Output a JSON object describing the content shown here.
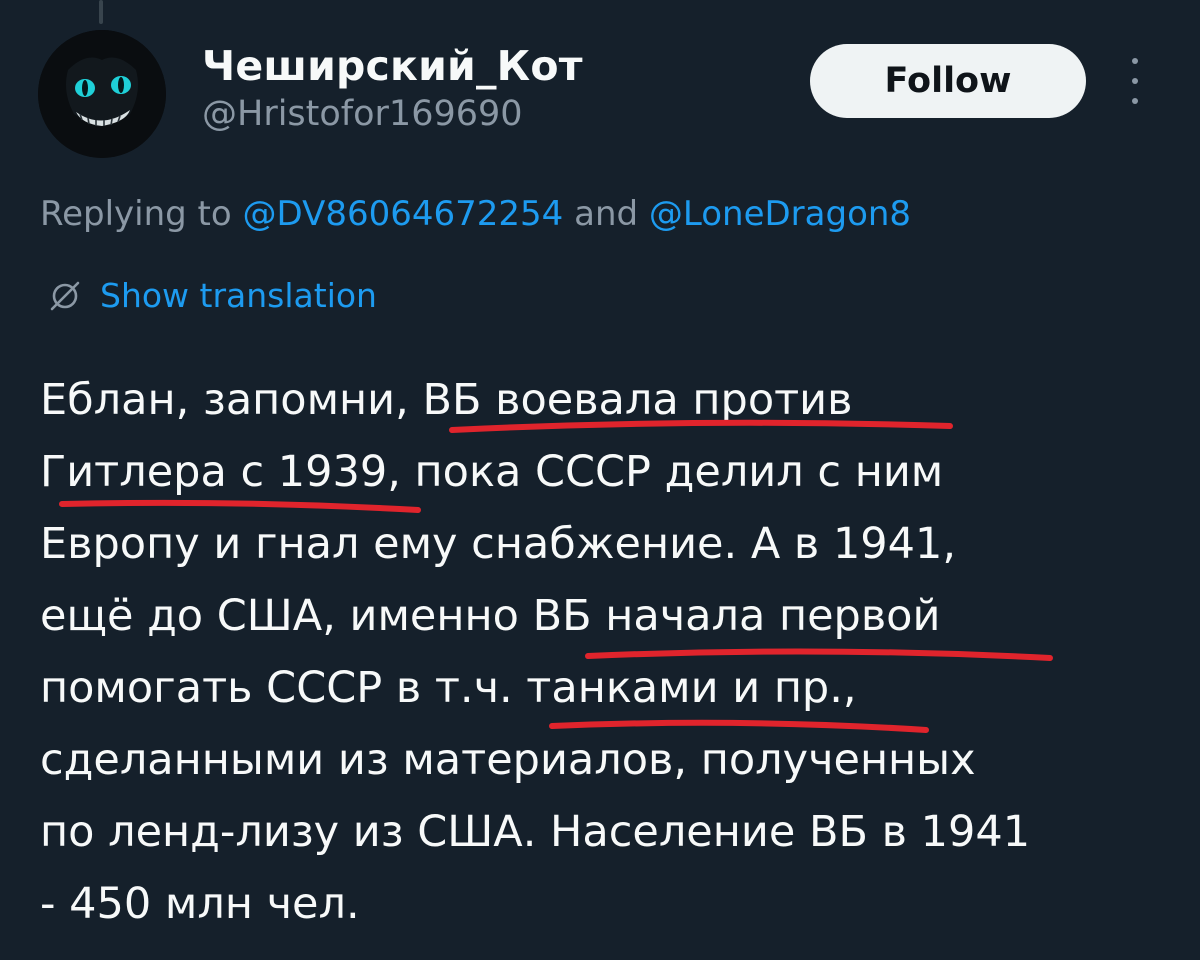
{
  "author": {
    "display_name": "Чеширский_Кот",
    "handle": "@Hristofor169690"
  },
  "actions": {
    "follow_label": "Follow"
  },
  "reply": {
    "prefix": "Replying to ",
    "mention_1": "@DV86064672254",
    "connector": " and ",
    "mention_2": "@LoneDragon8"
  },
  "translation": {
    "label": "Show translation",
    "icon": "globe-icon"
  },
  "tweet": {
    "lines": [
      "Еблан, запомни, ВБ воевала против",
      "Гитлера с 1939, пока СССР делил с ним",
      "Европу и гнал ему снабжение. А в 1941,",
      "ещё до США, именно ВБ начала первой",
      "помогать СССР в т.ч. танками и пр.,",
      "сделанными из материалов, полученных",
      "по ленд-лизу из США. Население ВБ в 1941",
      "- 450 млн чел."
    ]
  },
  "colors": {
    "background": "#15202b",
    "text": "#f7f9f9",
    "secondary_text": "#8b98a5",
    "link": "#1d9bf0",
    "annotation": "#e0242c",
    "follow_bg": "#eff3f4"
  }
}
